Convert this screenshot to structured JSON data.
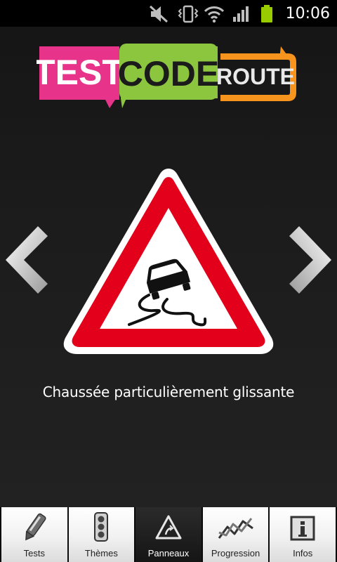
{
  "status_bar": {
    "time": "10:06",
    "icons": [
      "mute-icon",
      "vibrate-icon",
      "wifi-icon",
      "signal-icon",
      "battery-icon"
    ]
  },
  "app": {
    "logo": {
      "word1": "TEST",
      "word2": "CODE",
      "word3": "ROUTE"
    },
    "sign_caption": "Chaussée particulièrement glissante",
    "sign_icon": "slippery-road-sign"
  },
  "colors": {
    "logo_pink": "#e8338a",
    "logo_green": "#8cc63f",
    "logo_orange": "#f7941d",
    "sign_red": "#e2001a"
  },
  "tabs": [
    {
      "label": "Tests",
      "icon": "pencil-icon",
      "active": false
    },
    {
      "label": "Thèmes",
      "icon": "traffic-light-icon",
      "active": false
    },
    {
      "label": "Panneaux",
      "icon": "road-sign-icon",
      "active": true
    },
    {
      "label": "Progression",
      "icon": "chart-icon",
      "active": false
    },
    {
      "label": "Infos",
      "icon": "info-icon",
      "active": false
    }
  ]
}
